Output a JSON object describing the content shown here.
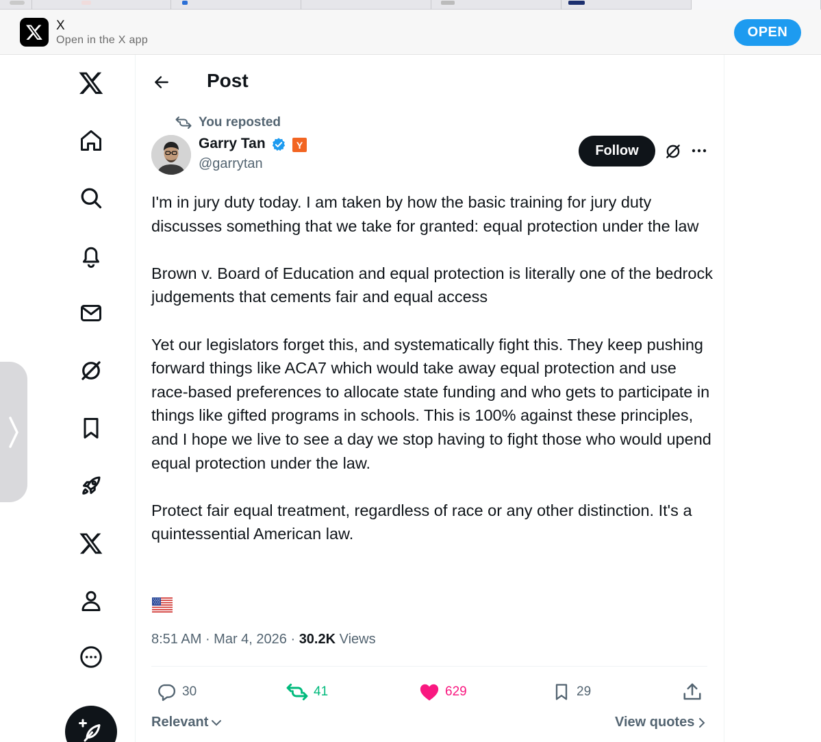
{
  "banner": {
    "app_name": "X",
    "subtitle": "Open in the X app",
    "open_label": "OPEN"
  },
  "nav": {
    "items": [
      "x-logo",
      "home",
      "search",
      "notifications",
      "messages",
      "grok",
      "bookmarks",
      "jobs",
      "premium",
      "profile",
      "more"
    ]
  },
  "header": {
    "title": "Post"
  },
  "post": {
    "repost_label": "You reposted",
    "author_name": "Garry Tan",
    "badge_label": "Y",
    "handle": "@garrytan",
    "follow_label": "Follow",
    "paragraphs": [
      "I'm in jury duty today. I am taken by how the basic training for jury duty discusses something that we take for granted: equal protection under the law",
      "Brown v. Board of Education and equal protection is literally one of the bedrock judgements that cements fair and equal access",
      "Yet our legislators forget this, and systematically fight this. They keep pushing forward things like ACA7 which would take away equal protection and use race-based preferences to allocate state funding and who gets to participate in things like gifted programs in schools. This is 100% against these principles, and I hope we live to see a day we stop having to fight those who would upend equal protection under the law.",
      "Protect fair equal treatment, regardless of race or any other distinction. It's a quintessential American law."
    ],
    "time": "8:51 AM",
    "date": "Mar 4, 2026",
    "views_count": "30.2K",
    "views_label": "Views"
  },
  "actions": {
    "replies": "30",
    "reposts": "41",
    "likes": "629",
    "bookmarks": "29"
  },
  "footer": {
    "sort_label": "Relevant",
    "quotes_label": "View quotes"
  },
  "colors": {
    "accent": "#1d9bf0",
    "repost": "#00ba7c",
    "like": "#f91880",
    "text_secondary": "#536471",
    "yc_orange": "#f26522"
  }
}
